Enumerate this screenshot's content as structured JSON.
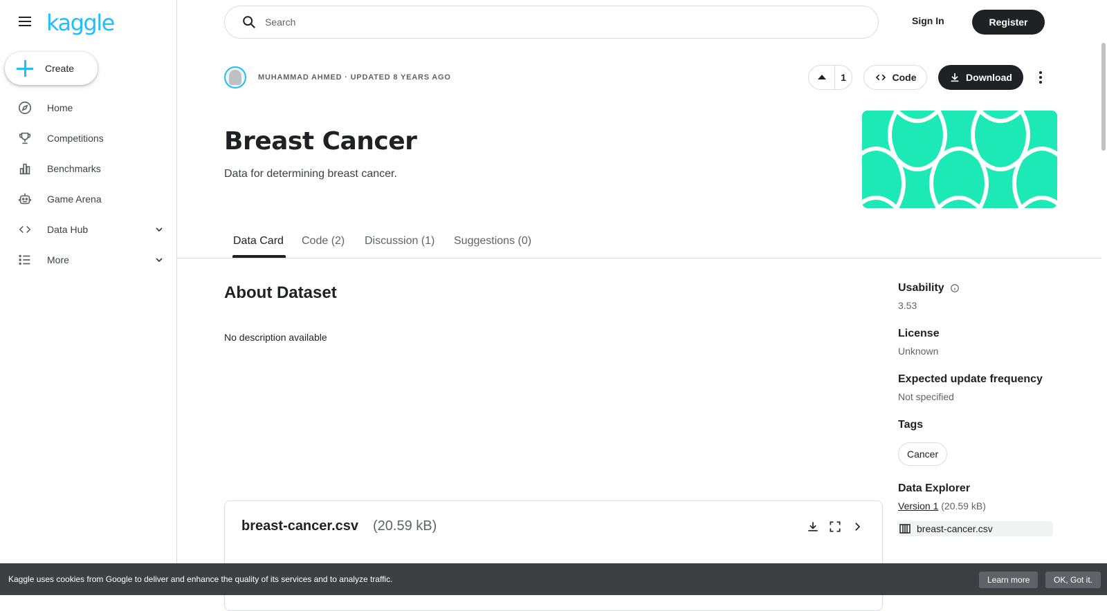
{
  "brand": {
    "logo": "kaggle",
    "accent": "#20beff"
  },
  "sidebar": {
    "create_label": "Create",
    "items": [
      {
        "label": "Home",
        "icon": "compass-icon"
      },
      {
        "label": "Competitions",
        "icon": "trophy-icon"
      },
      {
        "label": "Benchmarks",
        "icon": "bar-chart-icon"
      },
      {
        "label": "Game Arena",
        "icon": "robot-icon"
      },
      {
        "label": "Data Hub",
        "icon": "code-brackets-icon",
        "expandable": true
      },
      {
        "label": "More",
        "icon": "list-icon",
        "expandable": true
      }
    ]
  },
  "header": {
    "search_placeholder": "Search",
    "sign_in": "Sign In",
    "register": "Register"
  },
  "dataset": {
    "owner_line": "MUHAMMAD AHMED · UPDATED 8 YEARS AGO",
    "upvotes": "1",
    "code_label": "Code",
    "download_label": "Download",
    "title": "Breast Cancer",
    "subtitle": "Data for determining breast cancer.",
    "banner_color": "#1de9b6"
  },
  "tabs": [
    {
      "label": "Data Card",
      "active": true
    },
    {
      "label": "Code (2)"
    },
    {
      "label": "Discussion (1)"
    },
    {
      "label": "Suggestions (0)"
    }
  ],
  "about": {
    "heading": "About Dataset",
    "description": "No description available"
  },
  "file_card": {
    "name": "breast-cancer.csv",
    "size": "(20.59 kB)"
  },
  "side": {
    "usability_label": "Usability",
    "usability_value": "3.53",
    "license_label": "License",
    "license_value": "Unknown",
    "frequency_label": "Expected update frequency",
    "frequency_value": "Not specified",
    "tags_label": "Tags",
    "tags": [
      "Cancer"
    ],
    "explorer_label": "Data Explorer",
    "version_link": "Version 1",
    "version_size": "(20.59 kB)",
    "explorer_file": "breast-cancer.csv"
  },
  "cookie": {
    "text": "Kaggle uses cookies from Google to deliver and enhance the quality of its services and to analyze traffic.",
    "learn_more": "Learn more",
    "ok": "OK, Got it."
  }
}
